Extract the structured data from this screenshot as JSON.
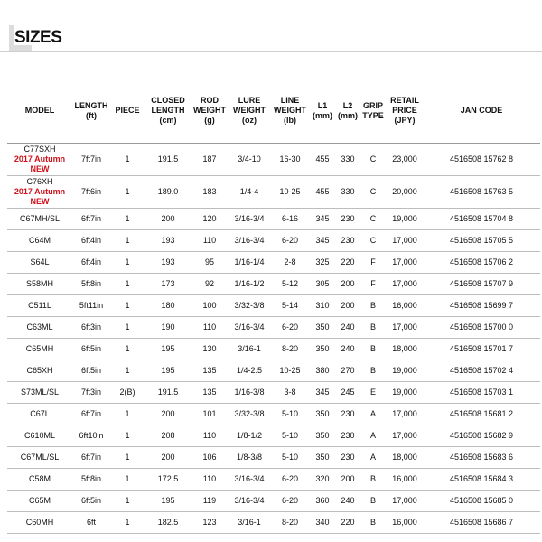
{
  "header": {
    "title": "SIZES"
  },
  "table": {
    "columns": [
      {
        "line1": "MODEL",
        "line2": "",
        "line3": ""
      },
      {
        "line1": "LENGTH",
        "line2": "(ft)",
        "line3": ""
      },
      {
        "line1": "PIECE",
        "line2": "",
        "line3": ""
      },
      {
        "line1": "CLOSED",
        "line2": "LENGTH",
        "line3": "(cm)"
      },
      {
        "line1": "ROD",
        "line2": "WEIGHT",
        "line3": "(g)"
      },
      {
        "line1": "LURE",
        "line2": "WEIGHT",
        "line3": "(oz)"
      },
      {
        "line1": "LINE",
        "line2": "WEIGHT",
        "line3": "(lb)"
      },
      {
        "line1": "L1",
        "line2": "(mm)",
        "line3": ""
      },
      {
        "line1": "L2",
        "line2": "(mm)",
        "line3": ""
      },
      {
        "line1": "GRIP",
        "line2": "TYPE",
        "line3": ""
      },
      {
        "line1": "RETAIL",
        "line2": "PRICE",
        "line3": "(JPY)"
      },
      {
        "line1": "JAN CODE",
        "line2": "",
        "line3": ""
      }
    ],
    "rows": [
      {
        "model": "C77SXH",
        "note": "2017 Autumn NEW",
        "length": "7ft7in",
        "piece": "1",
        "closed": "191.5",
        "rod_weight": "187",
        "lure": "3/4-10",
        "line": "16-30",
        "l1": "455",
        "l2": "330",
        "grip": "C",
        "price": "23,000",
        "jan": "4516508 15762 8"
      },
      {
        "model": "C76XH",
        "note": "2017 Autumn NEW",
        "length": "7ft6in",
        "piece": "1",
        "closed": "189.0",
        "rod_weight": "183",
        "lure": "1/4-4",
        "line": "10-25",
        "l1": "455",
        "l2": "330",
        "grip": "C",
        "price": "20,000",
        "jan": "4516508 15763 5"
      },
      {
        "model": "C67MH/SL",
        "note": "",
        "length": "6ft7in",
        "piece": "1",
        "closed": "200",
        "rod_weight": "120",
        "lure": "3/16-3/4",
        "line": "6-16",
        "l1": "345",
        "l2": "230",
        "grip": "C",
        "price": "19,000",
        "jan": "4516508 15704 8"
      },
      {
        "model": "C64M",
        "note": "",
        "length": "6ft4in",
        "piece": "1",
        "closed": "193",
        "rod_weight": "110",
        "lure": "3/16-3/4",
        "line": "6-20",
        "l1": "345",
        "l2": "230",
        "grip": "C",
        "price": "17,000",
        "jan": "4516508 15705 5"
      },
      {
        "model": "S64L",
        "note": "",
        "length": "6ft4in",
        "piece": "1",
        "closed": "193",
        "rod_weight": "95",
        "lure": "1/16-1/4",
        "line": "2-8",
        "l1": "325",
        "l2": "220",
        "grip": "F",
        "price": "17,000",
        "jan": "4516508 15706 2"
      },
      {
        "model": "S58MH",
        "note": "",
        "length": "5ft8in",
        "piece": "1",
        "closed": "173",
        "rod_weight": "92",
        "lure": "1/16-1/2",
        "line": "5-12",
        "l1": "305",
        "l2": "200",
        "grip": "F",
        "price": "17,000",
        "jan": "4516508 15707 9"
      },
      {
        "model": "C511L",
        "note": "",
        "length": "5ft11in",
        "piece": "1",
        "closed": "180",
        "rod_weight": "100",
        "lure": "3/32-3/8",
        "line": "5-14",
        "l1": "310",
        "l2": "200",
        "grip": "B",
        "price": "16,000",
        "jan": "4516508 15699 7"
      },
      {
        "model": "C63ML",
        "note": "",
        "length": "6ft3in",
        "piece": "1",
        "closed": "190",
        "rod_weight": "110",
        "lure": "3/16-3/4",
        "line": "6-20",
        "l1": "350",
        "l2": "240",
        "grip": "B",
        "price": "17,000",
        "jan": "4516508 15700 0"
      },
      {
        "model": "C65MH",
        "note": "",
        "length": "6ft5in",
        "piece": "1",
        "closed": "195",
        "rod_weight": "130",
        "lure": "3/16-1",
        "line": "8-20",
        "l1": "350",
        "l2": "240",
        "grip": "B",
        "price": "18,000",
        "jan": "4516508 15701 7"
      },
      {
        "model": "C65XH",
        "note": "",
        "length": "6ft5in",
        "piece": "1",
        "closed": "195",
        "rod_weight": "135",
        "lure": "1/4-2.5",
        "line": "10-25",
        "l1": "380",
        "l2": "270",
        "grip": "B",
        "price": "19,000",
        "jan": "4516508 15702 4"
      },
      {
        "model": "S73ML/SL",
        "note": "",
        "length": "7ft3in",
        "piece": "2(B)",
        "closed": "191.5",
        "rod_weight": "135",
        "lure": "1/16-3/8",
        "line": "3-8",
        "l1": "345",
        "l2": "245",
        "grip": "E",
        "price": "19,000",
        "jan": "4516508 15703 1"
      },
      {
        "model": "C67L",
        "note": "",
        "length": "6ft7in",
        "piece": "1",
        "closed": "200",
        "rod_weight": "101",
        "lure": "3/32-3/8",
        "line": "5-10",
        "l1": "350",
        "l2": "230",
        "grip": "A",
        "price": "17,000",
        "jan": "4516508 15681 2"
      },
      {
        "model": "C610ML",
        "note": "",
        "length": "6ft10in",
        "piece": "1",
        "closed": "208",
        "rod_weight": "110",
        "lure": "1/8-1/2",
        "line": "5-10",
        "l1": "350",
        "l2": "230",
        "grip": "A",
        "price": "17,000",
        "jan": "4516508 15682 9"
      },
      {
        "model": "C67ML/SL",
        "note": "",
        "length": "6ft7in",
        "piece": "1",
        "closed": "200",
        "rod_weight": "106",
        "lure": "1/8-3/8",
        "line": "5-10",
        "l1": "350",
        "l2": "230",
        "grip": "A",
        "price": "18,000",
        "jan": "4516508 15683 6"
      },
      {
        "model": "C58M",
        "note": "",
        "length": "5ft8in",
        "piece": "1",
        "closed": "172.5",
        "rod_weight": "110",
        "lure": "3/16-3/4",
        "line": "6-20",
        "l1": "320",
        "l2": "200",
        "grip": "B",
        "price": "16,000",
        "jan": "4516508 15684 3"
      },
      {
        "model": "C65M",
        "note": "",
        "length": "6ft5in",
        "piece": "1",
        "closed": "195",
        "rod_weight": "119",
        "lure": "3/16-3/4",
        "line": "6-20",
        "l1": "360",
        "l2": "240",
        "grip": "B",
        "price": "17,000",
        "jan": "4516508 15685 0"
      },
      {
        "model": "C60MH",
        "note": "",
        "length": "6ft",
        "piece": "1",
        "closed": "182.5",
        "rod_weight": "123",
        "lure": "3/16-1",
        "line": "8-20",
        "l1": "340",
        "l2": "220",
        "grip": "B",
        "price": "16,000",
        "jan": "4516508 15686 7"
      }
    ]
  }
}
